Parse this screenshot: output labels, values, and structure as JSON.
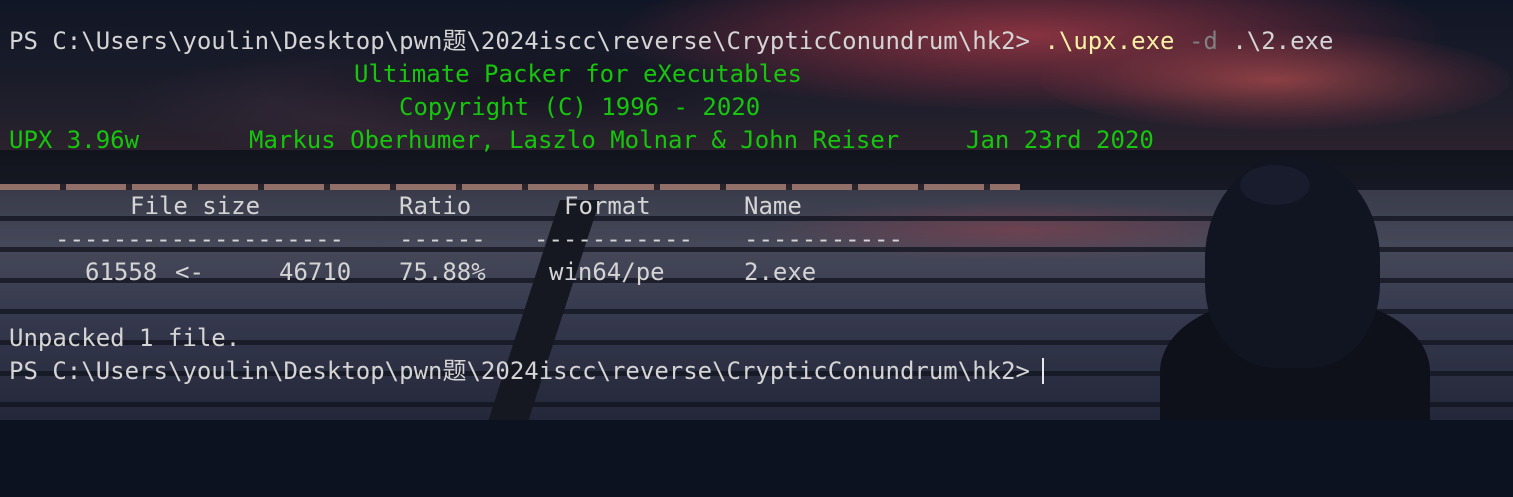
{
  "terminal": {
    "prompt": "PS C:\\Users\\youlin\\Desktop\\pwn题\\2024iscc\\reverse\\CrypticConundrum\\hk2>",
    "command": {
      "exe": ".\\upx.exe",
      "flag": "-d",
      "arg": ".\\2.exe"
    },
    "banner": {
      "title": "Ultimate Packer for eXecutables",
      "copyright": "Copyright (C) 1996 - 2020",
      "version": "UPX 3.96w",
      "authors": "Markus Oberhumer, Laszlo Molnar & John Reiser",
      "date": "Jan 23rd 2020"
    },
    "table": {
      "headers": {
        "file_size": "File size",
        "ratio": "Ratio",
        "format": "Format",
        "name": "Name"
      },
      "separators": {
        "file_size": "--------------------",
        "ratio": "------",
        "format": "-----------",
        "name": "-----------"
      },
      "row": {
        "unpacked_size": "61558",
        "arrow": "<-",
        "packed_size": "46710",
        "ratio": "75.88%",
        "format": "win64/pe",
        "name": "2.exe"
      }
    },
    "summary": "Unpacked 1 file.",
    "colors": {
      "text": "#d4d4d4",
      "banner_green": "#16c60c",
      "command_yellow": "#f9f1a5",
      "flag_gray": "#808080"
    }
  }
}
